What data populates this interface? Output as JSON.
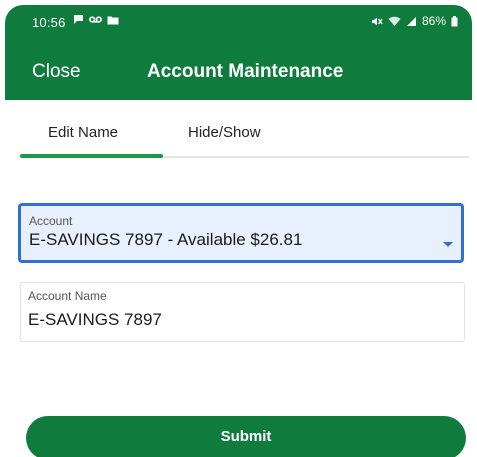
{
  "status_bar": {
    "time": "10:56",
    "battery": "86%",
    "left_icons": [
      "chat-bubble-icon",
      "voicemail-icon",
      "folder-icon"
    ],
    "right_icons": [
      "mute-icon",
      "wifi-icon",
      "signal-icon",
      "battery-icon"
    ]
  },
  "header": {
    "close_label": "Close",
    "title": "Account Maintenance",
    "background": "#0f7c3e"
  },
  "tabs": [
    {
      "label": "Edit Name",
      "active": true
    },
    {
      "label": "Hide/Show",
      "active": false
    }
  ],
  "account_select": {
    "label": "Account",
    "value": "E-SAVINGS 7897 - Available $26.81"
  },
  "account_name": {
    "label": "Account Name",
    "value": "E-SAVINGS 7897"
  },
  "submit": {
    "label": "Submit"
  },
  "colors": {
    "brand_green": "#0f7c3e",
    "tab_indicator": "#1a9a4a",
    "focus_blue": "#2f6fd6",
    "focus_fill": "#e8f0fe"
  }
}
